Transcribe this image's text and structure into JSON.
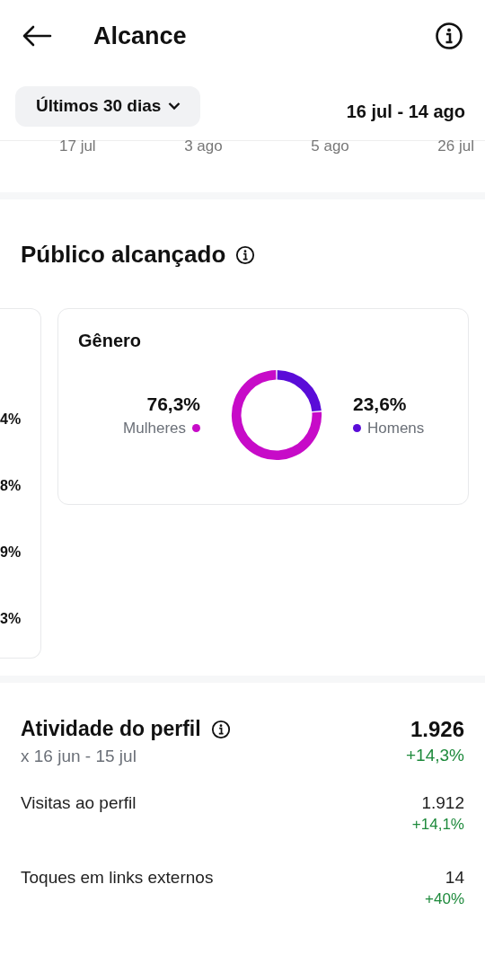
{
  "header": {
    "title": "Alcance"
  },
  "filter": {
    "period": "Últimos 30 dias",
    "range": "16 jul - 14 ago"
  },
  "axis_labels": [
    "17 jul",
    "3 ago",
    "5 ago",
    "26 jul"
  ],
  "audience": {
    "title": "Público alcançado",
    "partial_card": {
      "values": [
        "4%",
        "8%",
        "9%",
        "3%"
      ]
    },
    "gender_card": {
      "chart_data": {
        "type": "donut",
        "title": "Gênero",
        "categories": [
          "Mulheres",
          "Homens"
        ],
        "values": [
          76.3,
          23.6
        ]
      },
      "legend": [
        {
          "value": "76,3%",
          "color": "#c70bc8"
        },
        {
          "value": "23,6%",
          "color": "#5a0cd8"
        }
      ]
    }
  },
  "activity": {
    "title": "Atividade do perfil",
    "comparison": "x 16 jun - 15 jul",
    "total": "1.926",
    "total_change": "+14,3%",
    "rows": [
      {
        "label": "Visitas ao perfil",
        "value": "1.912",
        "change": "+14,1%"
      },
      {
        "label": "Toques em links externos",
        "value": "14",
        "change": "+40%"
      }
    ]
  }
}
